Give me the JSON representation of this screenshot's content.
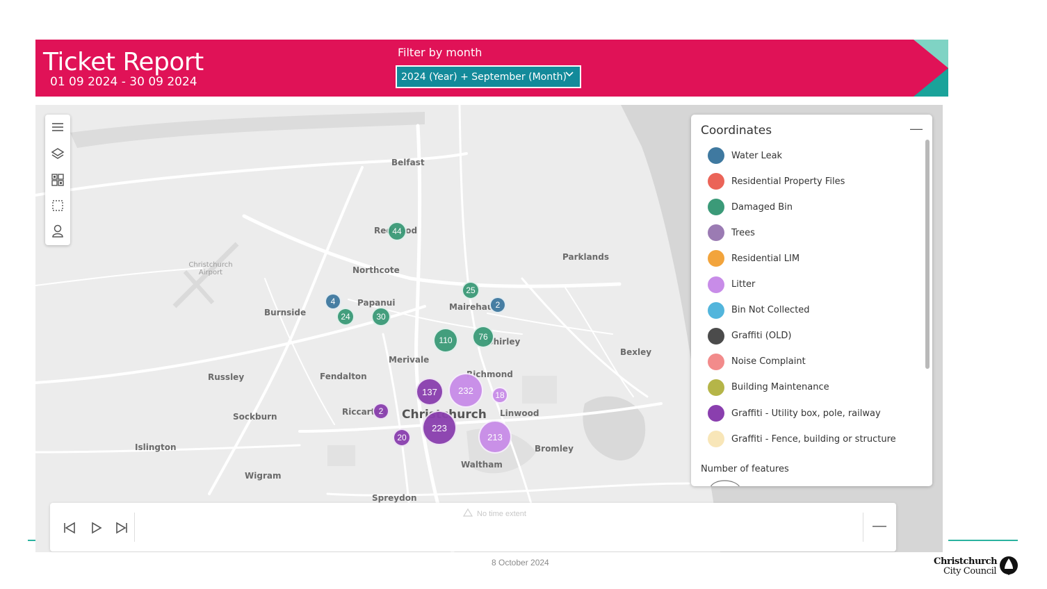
{
  "header": {
    "title": "Ticket Report",
    "date_range": "01 09 2024 - 30 09 2024",
    "filter_label": "Filter by month",
    "filter_value": "2024 (Year) + September (Month)",
    "banner_color": "#e01257",
    "accent_teal": "#1aa39a"
  },
  "map": {
    "places": {
      "belfast": "Belfast",
      "redwood": "Redwood",
      "northcote": "Northcote",
      "parklands": "Parklands",
      "papanui": "Papanui",
      "mairehau": "Mairehau",
      "burnside": "Burnside",
      "shirley": "Shirley",
      "merivale": "Merivale",
      "bexley": "Bexley",
      "richmond": "Richmond",
      "russley": "Russley",
      "fendalton": "Fendalton",
      "riccarton": "Riccarton",
      "christchurch": "Christchurch",
      "linwood": "Linwood",
      "sockburn": "Sockburn",
      "islington": "Islington",
      "bromley": "Bromley",
      "waltham": "Waltham",
      "wigram": "Wigram",
      "spreydon": "Spreydon",
      "airport": "Christchurch Airport"
    },
    "clusters": [
      {
        "label": "44",
        "category": "Damaged Bin"
      },
      {
        "label": "25",
        "category": "Damaged Bin"
      },
      {
        "label": "4",
        "category": "Water Leak"
      },
      {
        "label": "2",
        "category": "Water Leak"
      },
      {
        "label": "24",
        "category": "Damaged Bin"
      },
      {
        "label": "30",
        "category": "Damaged Bin"
      },
      {
        "label": "110",
        "category": "Damaged Bin"
      },
      {
        "label": "76",
        "category": "Damaged Bin"
      },
      {
        "label": "137",
        "category": "Graffiti - Utility box, pole, railway"
      },
      {
        "label": "232",
        "category": "Litter"
      },
      {
        "label": "18",
        "category": "Litter"
      },
      {
        "label": "2",
        "category": "Graffiti - Utility box, pole, railway"
      },
      {
        "label": "223",
        "category": "Graffiti - Utility box, pole, railway"
      },
      {
        "label": "20",
        "category": "Graffiti - Utility box, pole, railway"
      },
      {
        "label": "213",
        "category": "Litter"
      }
    ]
  },
  "legend": {
    "title": "Coordinates",
    "items": [
      {
        "label": "Water Leak",
        "color": "#3f79a0"
      },
      {
        "label": "Residential Property Files",
        "color": "#eb6458"
      },
      {
        "label": "Damaged Bin",
        "color": "#3b9a78"
      },
      {
        "label": "Trees",
        "color": "#9b7bb3"
      },
      {
        "label": "Residential LIM",
        "color": "#f2a43c"
      },
      {
        "label": "Litter",
        "color": "#c88ce8"
      },
      {
        "label": "Bin Not Collected",
        "color": "#52b5dc"
      },
      {
        "label": "Graffiti (OLD)",
        "color": "#4b4b4b"
      },
      {
        "label": "Noise Complaint",
        "color": "#f28b8b"
      },
      {
        "label": "Building Maintenance",
        "color": "#b5b548"
      },
      {
        "label": "Graffiti - Utility box, pole, railway",
        "color": "#8a3fae"
      },
      {
        "label": "Graffiti - Fence, building or structure",
        "color": "#f8e6b8"
      }
    ],
    "features_label": "Number of features"
  },
  "timebar": {
    "no_extent": "No time extent"
  },
  "footer": {
    "date": "8 October 2024",
    "org_line1": "Christchurch",
    "org_line2": "City Council"
  }
}
